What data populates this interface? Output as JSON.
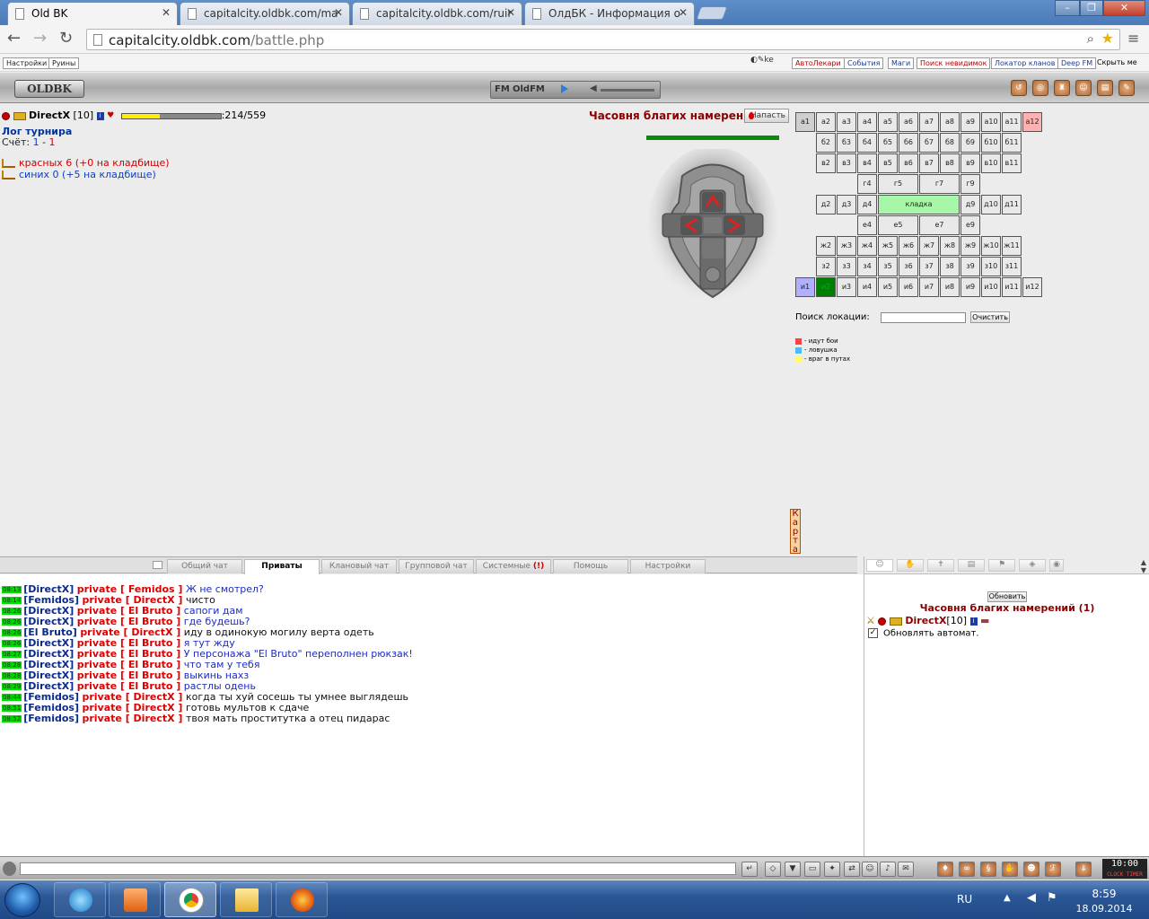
{
  "browser": {
    "tabs": [
      {
        "title": "Old BK",
        "active": true
      },
      {
        "title": "capitalcity.oldbk.com/ma",
        "active": false
      },
      {
        "title": "capitalcity.oldbk.com/ruir",
        "active": false
      },
      {
        "title": "ОлдБК - Информация о",
        "active": false
      }
    ],
    "url_host": "capitalcity.oldbk.com",
    "url_path": "/battle.php"
  },
  "bookmarks": {
    "left": [
      "Настройки",
      "Руины"
    ],
    "right": [
      "АвтоЛекари",
      "События",
      "Маги",
      "Поиск невидимок",
      "Локатор кланов",
      "Deep FM"
    ],
    "hide": "Скрыть ме"
  },
  "header": {
    "logo": "OLDBK",
    "radio_fm": "FM",
    "radio_name": "OldFM"
  },
  "player": {
    "name": "DirectX",
    "level": "[10]",
    "hp_text": ":214/559",
    "hp_fraction": 0.383
  },
  "log": {
    "title": "Лог турнира",
    "score_label": "Счёт:",
    "score_red": "1",
    "score_sep": "-",
    "score_blue": "1",
    "red_team": "красных 6 (+0 на кладбище)",
    "blue_team": "синих 0 (+5 на кладбище)"
  },
  "location": {
    "title": "Часовня благих намерений",
    "attack_label": "Напасть",
    "map_vertical": "Карта"
  },
  "map": {
    "rows": [
      {
        "label": "а",
        "cells": [
          "а1",
          "а2",
          "а3",
          "а4",
          "а5",
          "а6",
          "а7",
          "а8",
          "а9",
          "а10",
          "а11",
          "а12"
        ]
      },
      {
        "label": "б",
        "cells": [
          "",
          "б2",
          "б3",
          "б4",
          "б5",
          "б6",
          "б7",
          "б8",
          "б9",
          "б10",
          "б11",
          ""
        ]
      },
      {
        "label": "в",
        "cells": [
          "",
          "в2",
          "в3",
          "в4",
          "в5",
          "в6",
          "в7",
          "в8",
          "в9",
          "в10",
          "в11",
          ""
        ]
      },
      {
        "label": "г",
        "cells": [
          "",
          "",
          "",
          "г4",
          "",
          "г5",
          "",
          "г7",
          "г9",
          "",
          "",
          ""
        ]
      },
      {
        "label": "д",
        "cells": [
          "",
          "д2",
          "д3",
          "д4",
          "кладка",
          "д9",
          "д10",
          "д11"
        ]
      },
      {
        "label": "е",
        "cells": [
          "",
          "",
          "",
          "е4",
          "",
          "е5",
          "",
          "е7",
          "е9",
          "",
          "",
          ""
        ]
      },
      {
        "label": "ж",
        "cells": [
          "",
          "ж2",
          "ж3",
          "ж4",
          "ж5",
          "ж6",
          "ж7",
          "ж8",
          "ж9",
          "ж10",
          "ж11",
          ""
        ]
      },
      {
        "label": "з",
        "cells": [
          "",
          "з2",
          "з3",
          "з4",
          "з5",
          "з6",
          "з7",
          "з8",
          "з9",
          "з10",
          "з11",
          ""
        ]
      },
      {
        "label": "и",
        "cells": [
          "и1",
          "и2",
          "и3",
          "и4",
          "и5",
          "и6",
          "и7",
          "и8",
          "и9",
          "и10",
          "и11",
          "и12"
        ]
      }
    ],
    "search_label": "Поиск локации:",
    "clear_button": "Очистить",
    "legend": [
      {
        "color": "#ff4040",
        "text": "- идут бои"
      },
      {
        "color": "#40c0ff",
        "text": "- ловушка"
      },
      {
        "color": "#ffff60",
        "text": "- враг в путах"
      }
    ]
  },
  "chat_tabs": [
    "Общий чат",
    "Приваты",
    "Клановый чат",
    "Групповой чат",
    "Системные",
    "Помощь",
    "Настройки"
  ],
  "chat": [
    {
      "time": "08:13",
      "from": "[DirectX]",
      "priv": "private [ Femidos ]",
      "text": "Ж не смотрел?",
      "dark": false
    },
    {
      "time": "08:14",
      "from": "[Femidos]",
      "priv": "private [ DirectX ]",
      "text": "чисто",
      "dark": true
    },
    {
      "time": "08:26",
      "from": "[DirectX]",
      "priv": "private [ El Bruto ]",
      "text": "сапоги дам",
      "dark": false
    },
    {
      "time": "08:26",
      "from": "[DirectX]",
      "priv": "private [ El Bruto ]",
      "text": "где будешь?",
      "dark": false
    },
    {
      "time": "08:26",
      "from": "[El Bruto]",
      "priv": "private [ DirectX ]",
      "text": "иду в одинокую могилу верта одеть",
      "dark": true
    },
    {
      "time": "08:26",
      "from": "[DirectX]",
      "priv": "private [ El Bruto ]",
      "text": "я тут жду",
      "dark": false
    },
    {
      "time": "08:27",
      "from": "[DirectX]",
      "priv": "private [ El Bruto ]",
      "text": "У персонажа \"El Bruto\" переполнен рюкзак!",
      "dark": false
    },
    {
      "time": "08:28",
      "from": "[DirectX]",
      "priv": "private [ El Bruto ]",
      "text": "что там у тебя",
      "dark": false
    },
    {
      "time": "08:28",
      "from": "[DirectX]",
      "priv": "private [ El Bruto ]",
      "text": "выкинь нахз",
      "dark": false
    },
    {
      "time": "08:29",
      "from": "[DirectX]",
      "priv": "private [ El Bruto ]",
      "text": "растлы одень",
      "dark": false
    },
    {
      "time": "08:44",
      "from": "[Femidos]",
      "priv": "private [ DirectX ]",
      "text": "когда ты хуй сосешь ты умнее выглядешь",
      "dark": true
    },
    {
      "time": "08:51",
      "from": "[Femidos]",
      "priv": "private [ DirectX ]",
      "text": "готовь мультов к сдаче",
      "dark": true
    },
    {
      "time": "08:52",
      "from": "[Femidos]",
      "priv": "private [ DirectX ]",
      "text": "твоя мать проститутка а отец пидарас",
      "dark": true
    }
  ],
  "right_panel": {
    "refresh_button": "Обновить",
    "title": "Часовня благих намерений (1)",
    "user_name": "DirectX",
    "user_level": "[10]",
    "auto_label": "Обновлять автомат.",
    "auto_checked": true
  },
  "clock": {
    "time": "10:00",
    "label": "CLOCK TIMER"
  },
  "taskbar": {
    "lang": "RU",
    "time": "8:59",
    "date": "18.09.2014"
  }
}
